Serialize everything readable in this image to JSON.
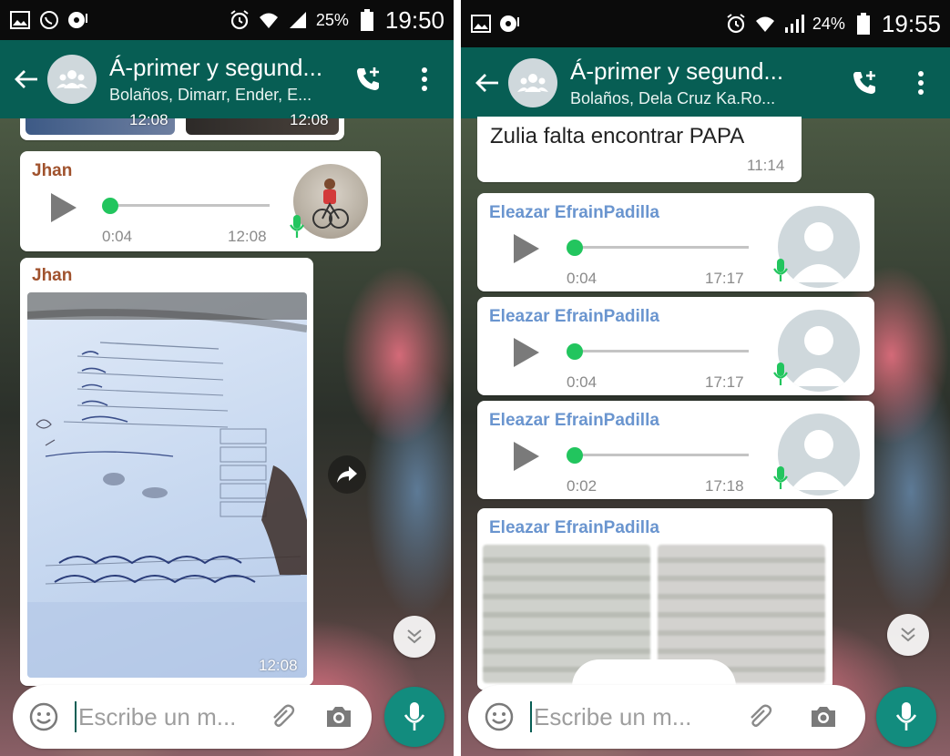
{
  "left": {
    "status": {
      "battery": "25%",
      "time": "19:50"
    },
    "header": {
      "title": "Á-primer y segund...",
      "subtitle": "Bolaños, Dimarr, Ender, E..."
    },
    "top_photos": {
      "timestamps": [
        "12:08",
        "12:08"
      ]
    },
    "voice_message": {
      "sender": "Jhan",
      "duration": "0:04",
      "time": "12:08"
    },
    "image_message": {
      "sender": "Jhan",
      "time": "12:08"
    },
    "composer": {
      "placeholder": "Escribe un m..."
    }
  },
  "right": {
    "status": {
      "battery": "24%",
      "time": "19:55"
    },
    "header": {
      "title": "Á-primer y segund...",
      "subtitle": "Bolaños, Dela Cruz Ka.Ro..."
    },
    "top_message": {
      "text": "Zulia falta encontrar PAPA",
      "time": "11:14"
    },
    "voice_messages": [
      {
        "sender": "Eleazar EfrainPadilla",
        "duration": "0:04",
        "time": "17:17"
      },
      {
        "sender": "Eleazar EfrainPadilla",
        "duration": "0:04",
        "time": "17:17"
      },
      {
        "sender": "Eleazar EfrainPadilla",
        "duration": "0:02",
        "time": "17:18"
      }
    ],
    "image_message": {
      "sender": "Eleazar EfrainPadilla"
    },
    "composer": {
      "placeholder": "Escribe un m..."
    }
  },
  "colors": {
    "appbar": "#075e54",
    "voice_button": "#128c7e",
    "progress_dot": "#22c55e",
    "sender_jhan": "#a0522d",
    "sender_eleazar": "#6a95cf"
  },
  "icons": [
    "gallery-icon",
    "whatsapp-icon",
    "location-icon",
    "alarm-icon",
    "wifi-icon",
    "signal-icon",
    "battery-icon",
    "back-arrow-icon",
    "group-icon",
    "add-call-icon",
    "more-vert-icon",
    "play-icon",
    "mic-icon",
    "forward-icon",
    "chevron-double-down-icon",
    "emoji-icon",
    "paperclip-icon",
    "camera-icon",
    "microphone-icon"
  ]
}
